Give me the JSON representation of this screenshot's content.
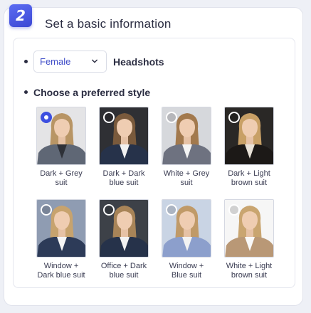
{
  "step": {
    "number": "2"
  },
  "section": {
    "title": "Set a basic information"
  },
  "gender": {
    "selected": "Female",
    "trailing_label": "Headshots"
  },
  "style": {
    "label": "Choose a preferred style",
    "selected_index": 0,
    "options": [
      {
        "line1": "Dark + Grey",
        "line2": "suit",
        "suit": "#5f6775",
        "bg": "#e4e4e6",
        "hair": "#b89565",
        "shirt": "#2e3138"
      },
      {
        "line1": "Dark + Dark",
        "line2": "blue suit",
        "suit": "#26324a",
        "bg": "#2f3034",
        "hair": "#7a5a3c",
        "shirt": "#f1f1f1"
      },
      {
        "line1": "White + Grey",
        "line2": "suit",
        "suit": "#6e7280",
        "bg": "#d6d8dc",
        "hair": "#a2794d",
        "shirt": "#f4f4f4"
      },
      {
        "line1": "Dark + Light",
        "line2": "brown suit",
        "suit": "#1c1917",
        "bg": "#2a2826",
        "hair": "#c8a066",
        "shirt": "#e8e2d8"
      },
      {
        "line1": "Window +",
        "line2": "Dark blue suit",
        "suit": "#2d3b58",
        "bg": "#8f9cb2",
        "hair": "#c7a36e",
        "shirt": "#f5f5f5"
      },
      {
        "line1": "Office + Dark",
        "line2": "blue suit",
        "suit": "#26324a",
        "bg": "#3d4148",
        "hair": "#a88458",
        "shirt": "#f2f2f2"
      },
      {
        "line1": "Window +",
        "line2": "Blue suit",
        "suit": "#8c9fcc",
        "bg": "#c9d4e4",
        "hair": "#c09a68",
        "shirt": "#f2f2f2"
      },
      {
        "line1": "White + Light",
        "line2": "brown suit",
        "suit": "#b99876",
        "bg": "#f6f6f6",
        "hair": "#c9a570",
        "shirt": "#f9f9f9"
      }
    ]
  }
}
